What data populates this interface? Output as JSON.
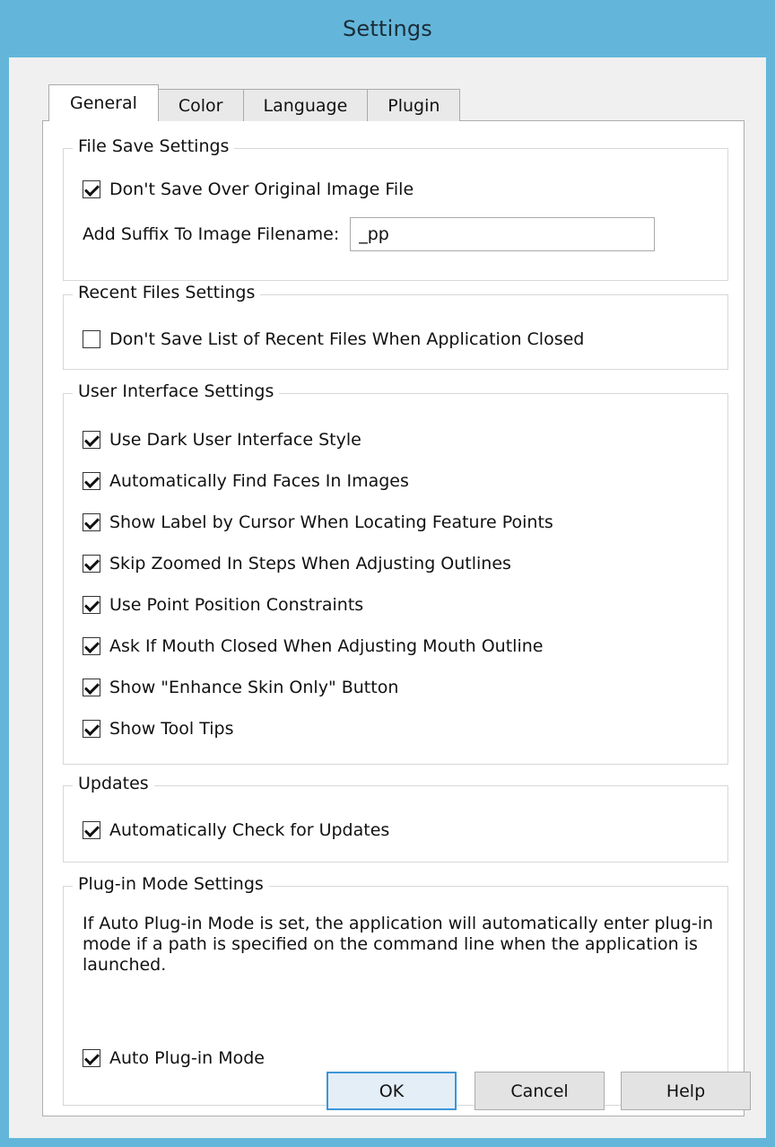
{
  "window": {
    "title": "Settings"
  },
  "tabs": [
    {
      "label": "General",
      "active": true
    },
    {
      "label": "Color",
      "active": false
    },
    {
      "label": "Language",
      "active": false
    },
    {
      "label": "Plugin",
      "active": false
    }
  ],
  "file_save": {
    "title": "File Save Settings",
    "dont_save_over": {
      "label": "Don't Save Over Original Image File",
      "checked": true
    },
    "suffix_label": "Add Suffix To Image Filename:",
    "suffix_value": "_pp"
  },
  "recent_files": {
    "title": "Recent Files Settings",
    "dont_save_list": {
      "label": "Don't Save List of Recent Files When Application Closed",
      "checked": false
    }
  },
  "user_interface": {
    "title": "User Interface Settings",
    "options": [
      {
        "label": "Use Dark User Interface Style",
        "checked": true
      },
      {
        "label": "Automatically Find Faces In Images",
        "checked": true
      },
      {
        "label": "Show Label by Cursor When Locating Feature Points",
        "checked": true
      },
      {
        "label": "Skip Zoomed In Steps When Adjusting Outlines",
        "checked": true
      },
      {
        "label": "Use Point Position Constraints",
        "checked": true
      },
      {
        "label": "Ask If Mouth Closed When Adjusting Mouth Outline",
        "checked": true
      },
      {
        "label": "Show \"Enhance Skin Only\" Button",
        "checked": true
      },
      {
        "label": "Show Tool Tips",
        "checked": true
      }
    ]
  },
  "updates": {
    "title": "Updates",
    "auto_check": {
      "label": "Automatically Check for Updates",
      "checked": true
    }
  },
  "plugin_mode": {
    "title": "Plug-in Mode Settings",
    "description": "If Auto Plug-in Mode is set, the application will automatically enter plug-in mode if a path is specified on the command line when the application is launched.",
    "auto_plugin": {
      "label": "Auto Plug-in Mode",
      "checked": true
    }
  },
  "buttons": {
    "ok": "OK",
    "cancel": "Cancel",
    "help": "Help"
  },
  "colors": {
    "titlebar": "#63b6da",
    "client_bg": "#f0f0f0",
    "default_button_border": "#3c96d8"
  }
}
